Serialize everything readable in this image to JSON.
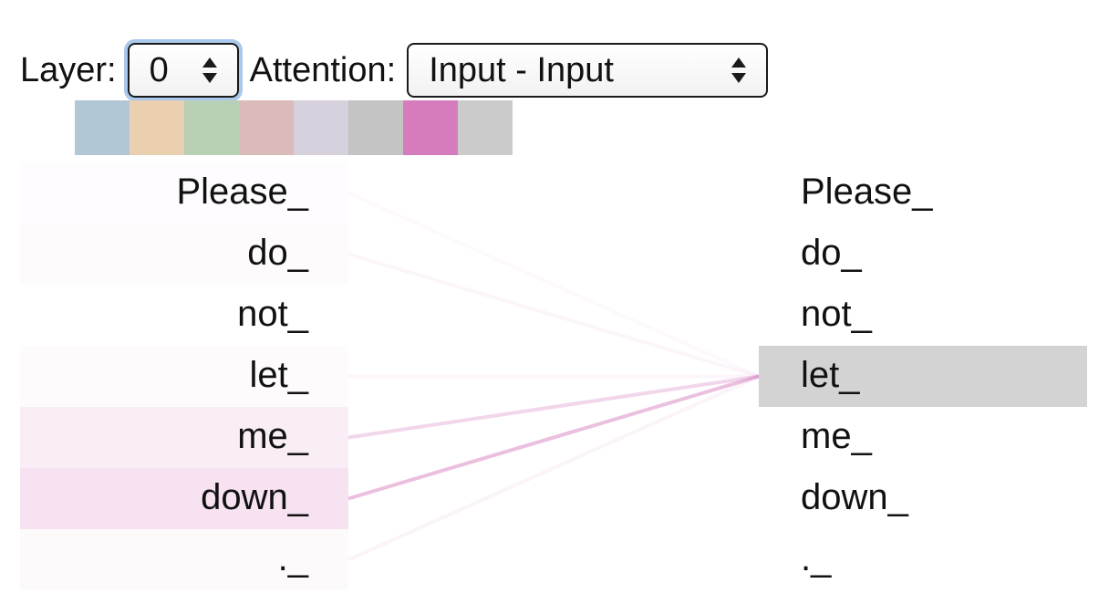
{
  "controls": {
    "layer_label": "Layer:",
    "layer_value": "0",
    "attention_label": "Attention:",
    "attention_value": "Input - Input"
  },
  "palette": [
    "#b1c7d6",
    "#ebcfb1",
    "#b9cfb6",
    "#dbbbb9",
    "#d6d1dc",
    "#c4c4c4",
    "#d67cbd",
    "#cbcbcb"
  ],
  "accent_color": "#d67cbd",
  "selected_color": "#d3d3d3",
  "tokens": [
    "Please_",
    "do_",
    "not_",
    "let_",
    "me_",
    "down_",
    "._"
  ],
  "selected_index": 3,
  "attention_weights": [
    0.02,
    0.03,
    0.0,
    0.03,
    0.14,
    0.22,
    0.04
  ]
}
